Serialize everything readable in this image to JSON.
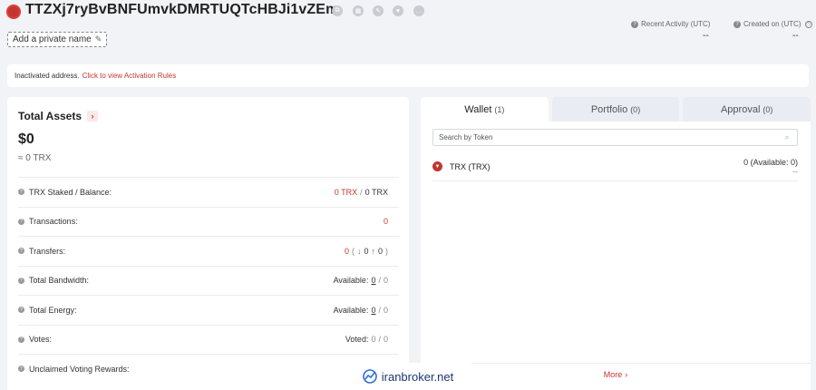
{
  "header": {
    "address": "TTZXj7ryBvBNFUmvkDMRTUQTcHBJi1vZEm",
    "private_name_label": "Add a private name",
    "recent_activity_label": "Recent Activity (UTC)",
    "recent_activity_value": "--",
    "created_on_label": "Created on (UTC)",
    "created_on_value": "--"
  },
  "notice": {
    "text": "Inactivated address.",
    "link": "Click to view Activation Rules"
  },
  "assets": {
    "title": "Total Assets",
    "usd": "$0",
    "trx": "≈ 0 TRX",
    "rows": [
      {
        "label": "TRX Staked / Balance:"
      },
      {
        "label": "Transactions:",
        "value": "0"
      },
      {
        "label": "Transfers:"
      },
      {
        "label": "Total Bandwidth:"
      },
      {
        "label": "Total Energy:"
      },
      {
        "label": "Votes:"
      },
      {
        "label": "Unclaimed Voting Rewards:"
      }
    ],
    "staked": {
      "staked": "0 TRX",
      "sep": "/",
      "balance": "0 TRX"
    },
    "transfers": {
      "total": "0",
      "open": "(",
      "in": "0",
      "out": "0",
      "close": ")"
    },
    "bandwidth": {
      "prefix": "Available:",
      "available": "0",
      "sep": "/",
      "total": "0"
    },
    "energy": {
      "prefix": "Available:",
      "available": "0",
      "sep": "/",
      "total": "0"
    },
    "votes": {
      "prefix": "Voted:",
      "voted": "0",
      "sep": "/",
      "total": "0"
    }
  },
  "tabs": [
    {
      "label": "Wallet",
      "count": "(1)"
    },
    {
      "label": "Portfolio",
      "count": "(0)"
    },
    {
      "label": "Approval",
      "count": "(0)"
    }
  ],
  "wallet": {
    "search_placeholder": "Search by Token",
    "token_name": "TRX (TRX)",
    "token_amount": "0 (Available: 0)",
    "token_value": "--",
    "more": "More"
  },
  "watermark": "iranbroker.net",
  "colors": {
    "accent": "#c23631",
    "background": "#f2f3f7"
  }
}
